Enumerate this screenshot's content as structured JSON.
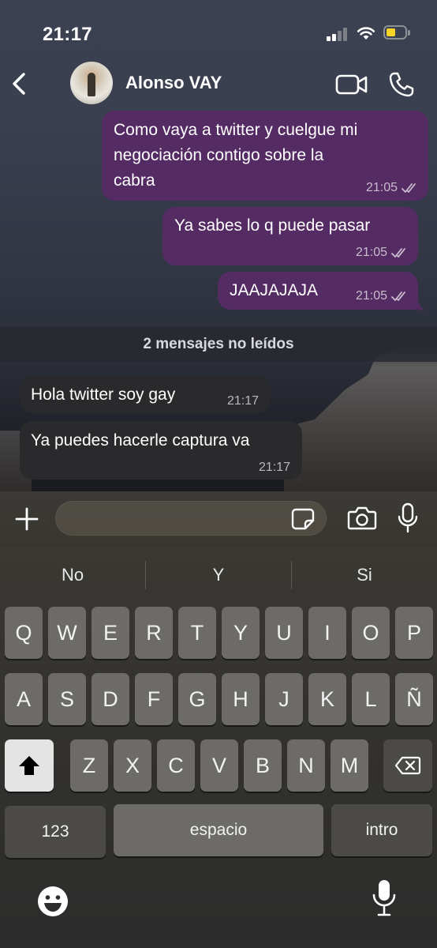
{
  "status_bar": {
    "time": "21:17"
  },
  "header": {
    "contact_name": "Alonso VAY"
  },
  "messages": [
    {
      "direction": "outgoing",
      "lines": [
        "Como vaya a twitter y cuelgue mi",
        "negociación contigo sobre la",
        "cabra"
      ],
      "time": "21:05",
      "read": true
    },
    {
      "direction": "outgoing",
      "lines": [
        "Ya sabes lo q puede pasar"
      ],
      "time": "21:05",
      "read": true
    },
    {
      "direction": "outgoing",
      "lines": [
        "JAAJAJAJA"
      ],
      "time": "21:05",
      "read": true
    },
    {
      "direction": "incoming",
      "lines": [
        "Hola twitter soy gay"
      ],
      "time": "21:17"
    },
    {
      "direction": "incoming",
      "lines": [
        "Ya puedes hacerle captura va"
      ],
      "time": "21:17"
    }
  ],
  "unread_divider": "2 mensajes no leídos",
  "input": {
    "value": ""
  },
  "suggestions": [
    "No",
    "Y",
    "Si"
  ],
  "keyboard": {
    "row1": [
      "Q",
      "W",
      "E",
      "R",
      "T",
      "Y",
      "U",
      "I",
      "O",
      "P"
    ],
    "row2": [
      "A",
      "S",
      "D",
      "F",
      "G",
      "H",
      "J",
      "K",
      "L",
      "Ñ"
    ],
    "row3": [
      "Z",
      "X",
      "C",
      "V",
      "B",
      "N",
      "M"
    ],
    "numbers_label": "123",
    "space_label": "espacio",
    "return_label": "intro"
  },
  "colors": {
    "outgoing_bubble": "#542b63",
    "incoming_bubble": "#2a2a2d",
    "battery": "#f5d425"
  }
}
